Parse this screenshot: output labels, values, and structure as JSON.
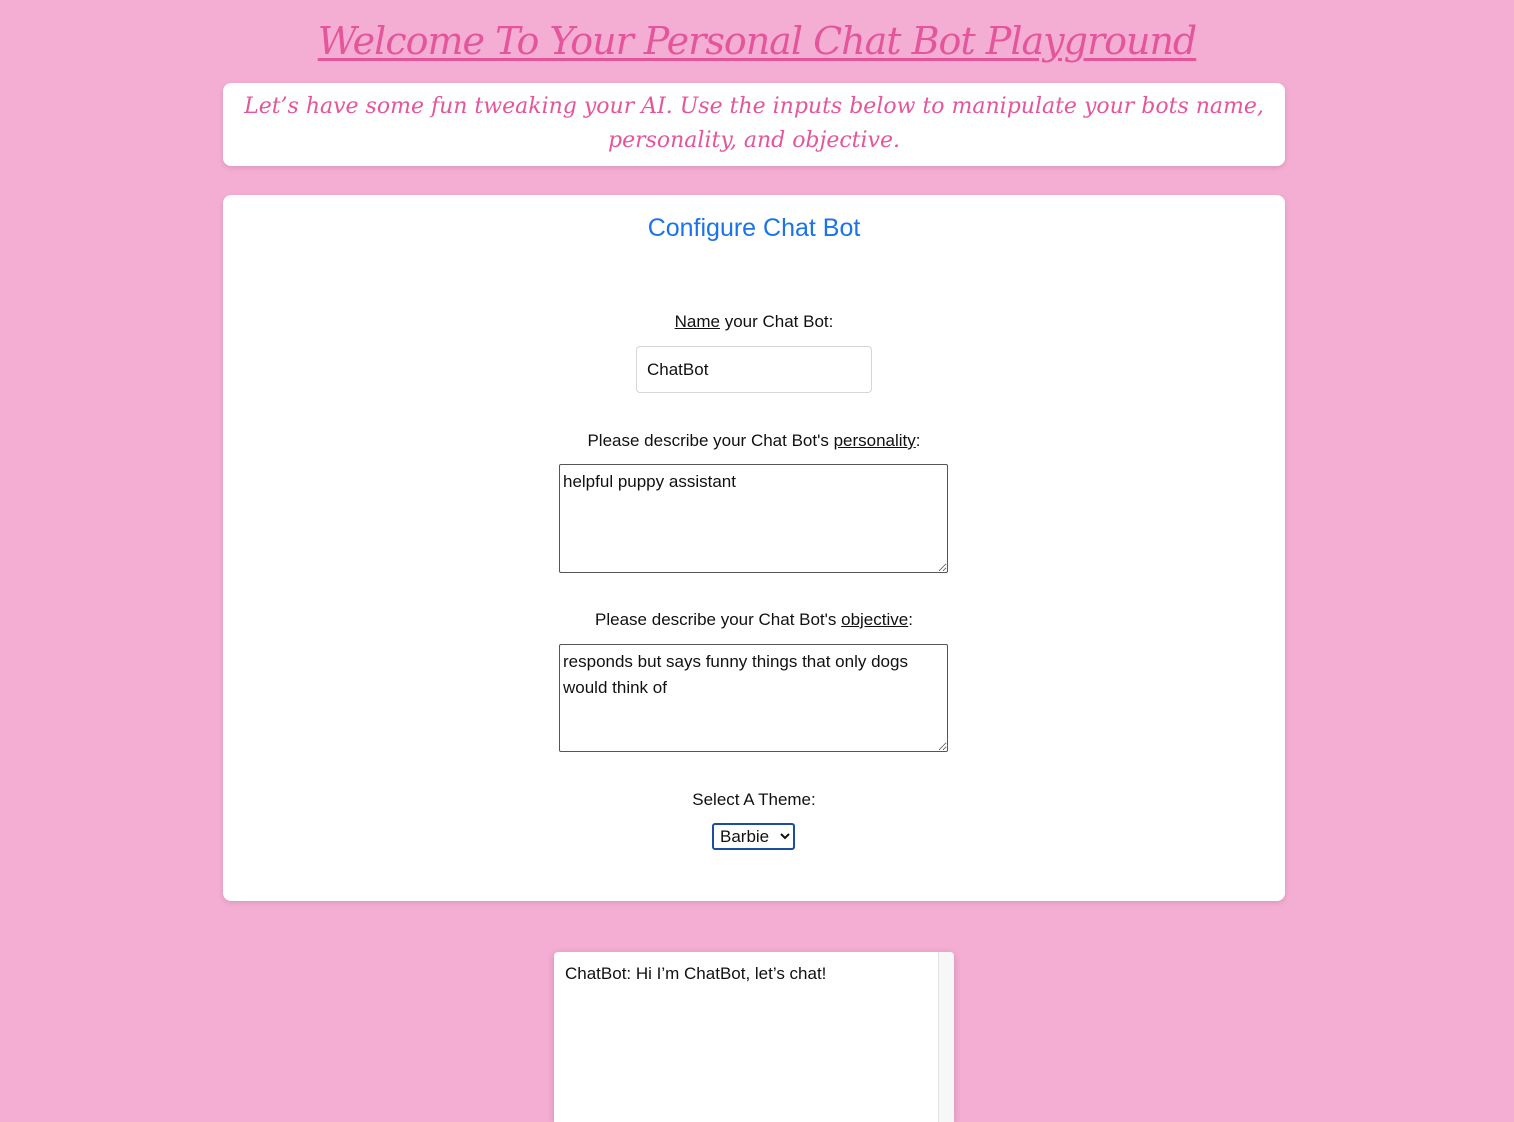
{
  "header": {
    "title": "Welcome To Your Personal Chat Bot Playground",
    "intro": "Let’s have some fun tweaking your AI. Use the inputs below to manipulate your bots name, personality, and objective."
  },
  "config": {
    "title": "Configure Chat Bot",
    "name_label_underlined": "Name",
    "name_label_rest": " your Chat Bot:",
    "name_value": "ChatBot",
    "personality_label_prefix": "Please describe your Chat Bot's ",
    "personality_label_underlined": "personality",
    "personality_label_suffix": ":",
    "personality_value": "helpful puppy assistant",
    "objective_label_prefix": "Please describe your Chat Bot's ",
    "objective_label_underlined": "objective",
    "objective_label_suffix": ":",
    "objective_value": "responds but says funny things that only dogs would think of",
    "theme_label": "Select A Theme:",
    "theme_selected": "Barbie"
  },
  "chat": {
    "message": "ChatBot: Hi I’m ChatBot, let’s chat!"
  },
  "colors": {
    "background": "#f5aed3",
    "accent_pink": "#e4559b",
    "title_blue": "#1a73e8"
  }
}
